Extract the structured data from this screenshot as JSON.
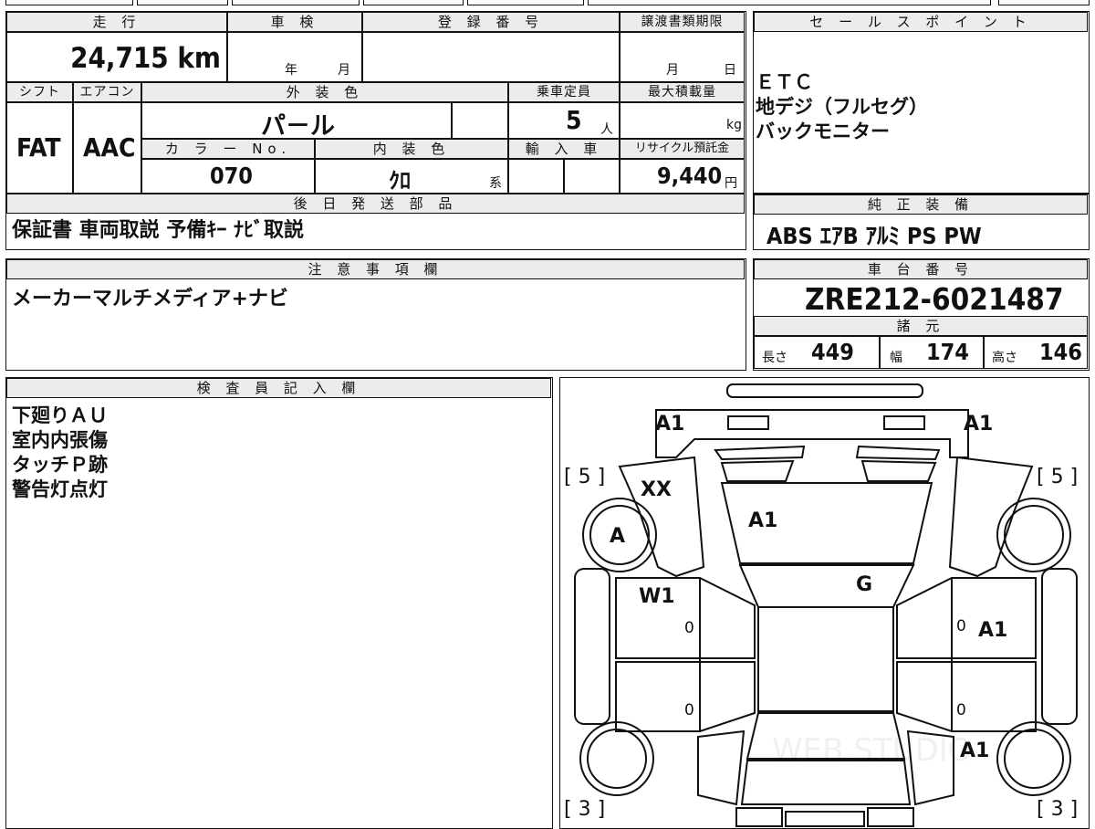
{
  "mileage": {
    "label": "走 行",
    "value": "24,715",
    "unit": "km"
  },
  "inspection": {
    "label": "車 検",
    "year_unit": "年",
    "month_unit": "月"
  },
  "registration": {
    "label": "登 録 番 号"
  },
  "transfer_deadline": {
    "label": "譲渡書類期限",
    "month_unit": "月",
    "day_unit": "日"
  },
  "shift": {
    "label": "シフト",
    "value": "FAT"
  },
  "aircon": {
    "label": "エアコン",
    "value": "AAC"
  },
  "exterior_color": {
    "label": "外 装 色",
    "value": "パ－ル"
  },
  "capacity": {
    "label": "乗車定員",
    "value": "5",
    "unit": "人"
  },
  "max_load": {
    "label": "最大積載量",
    "unit": "kg"
  },
  "color_no": {
    "label": "カ ラ ー No.",
    "value": "070"
  },
  "interior_color": {
    "label": "内 装 色",
    "value": "ｸﾛ",
    "suffix": "系"
  },
  "import": {
    "label": "輸 入 車"
  },
  "recycle": {
    "label": "リサイクル預託金",
    "value": "9,440",
    "unit": "円"
  },
  "sale_points": {
    "label": "セ ー ル ス ポ イ ン ト",
    "lines": [
      "ＥＴＣ",
      "地デジ（フルセグ）",
      "バックモニター"
    ]
  },
  "later_parts": {
    "label": "後 日 発 送 部 品",
    "value": "保証書 車両取説 予備ｷｰ ﾅﾋﾞ取説"
  },
  "standard_equipment": {
    "label": "純 正 装 備",
    "value": "ABS ｴｱB ｱﾙﾐ PS PW"
  },
  "notes": {
    "label": "注 意 事 項 欄",
    "value": "メーカーマルチメディア+ナビ"
  },
  "chassis_no": {
    "label": "車 台 番 号",
    "value": "ZRE212-6021487"
  },
  "specs": {
    "label": "諸 元",
    "length_label": "長さ",
    "length": "449",
    "width_label": "幅",
    "width": "174",
    "height_label": "高さ",
    "height": "146"
  },
  "inspector": {
    "label": "検 査 員 記 入 欄",
    "lines": [
      "下廻りＡＵ",
      "室内内張傷",
      "タッチＰ跡",
      "警告灯点灯"
    ]
  },
  "diagram": {
    "marks": {
      "front_left": "A1",
      "front_right": "A1",
      "fender_left": "XX",
      "hood": "A1",
      "wheel_fl": "A",
      "door_fl": "W1",
      "windshield": "G",
      "door_rr": "A1",
      "rear_right": "A1"
    },
    "tire_fl": "[ 5 ]",
    "tire_fr": "[ 5 ]",
    "tire_rl": "[ 3 ]",
    "tire_rr": "[ 3 ]",
    "zeros": [
      "0",
      "0",
      "0",
      "0"
    ],
    "watermark": "WEB STUDIO"
  }
}
